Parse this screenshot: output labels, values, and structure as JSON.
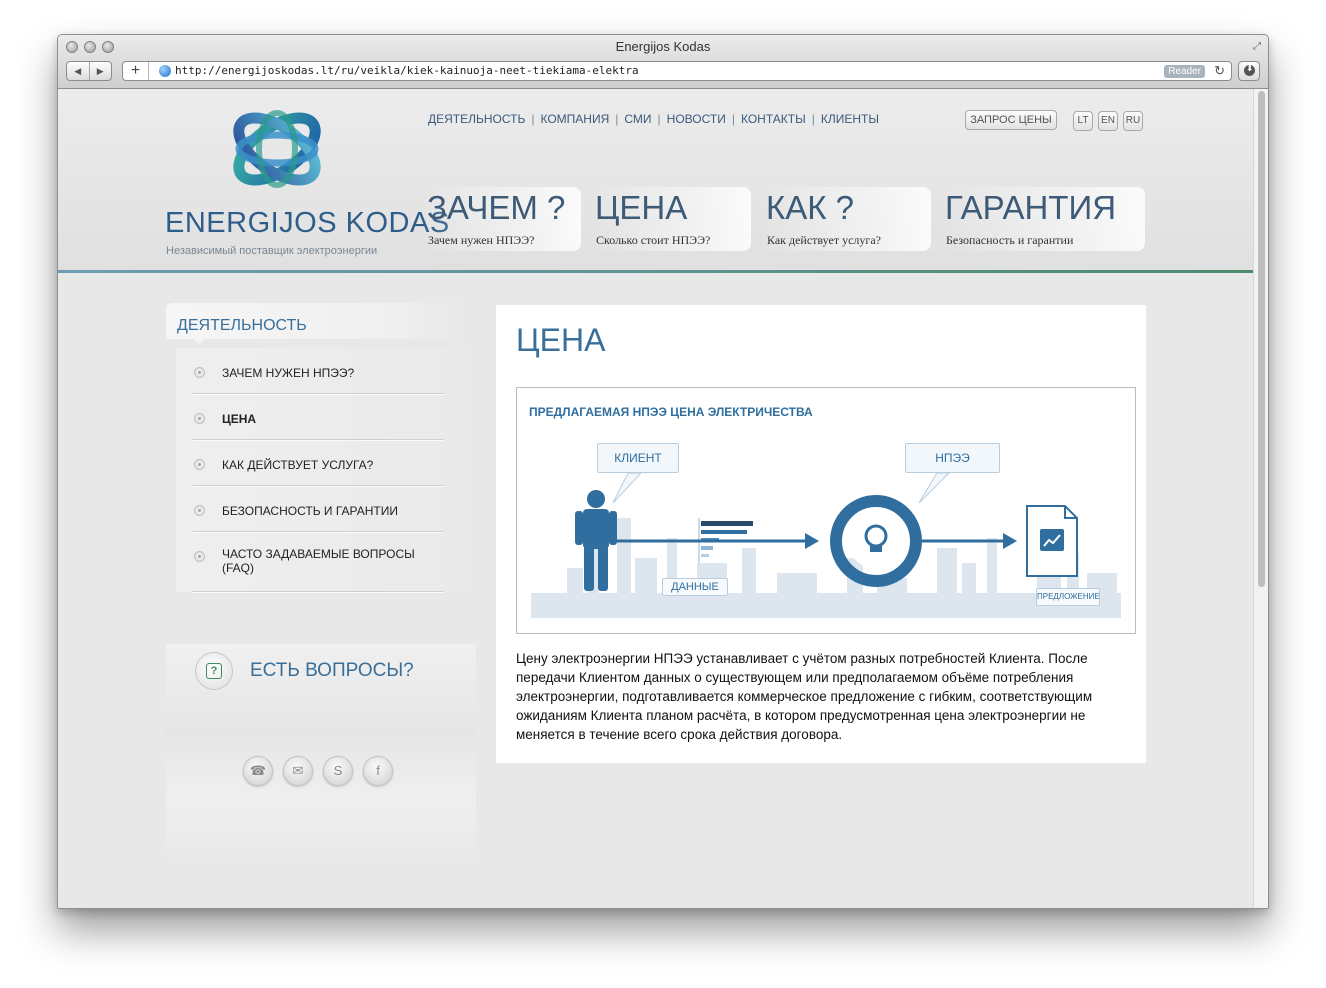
{
  "browser": {
    "window_title": "Energijos Kodas",
    "url": "http://energijoskodas.lt/ru/veikla/kiek-kainuoja-neet-tiekiama-elektra",
    "reader_label": "Reader"
  },
  "header": {
    "brand": "ENERGIJOS KODAS",
    "tagline": "Независимый поставщик электроэнергии",
    "top_nav": [
      "ДЕЯТЕЛЬНОСТЬ",
      "КОМПАНИЯ",
      "СМИ",
      "НОВОСТИ",
      "КОНТАКТЫ",
      "КЛИЕНТЫ"
    ],
    "nav_separator": "|",
    "quote_button": "ЗАПРОС ЦЕНЫ",
    "languages": [
      "LT",
      "EN",
      "RU"
    ],
    "tabs": [
      {
        "title": "ЗАЧЕМ ?",
        "subtitle": "Зачем нужен НПЭЭ?"
      },
      {
        "title": "ЦЕНА",
        "subtitle": "Сколько стоит НПЭЭ?"
      },
      {
        "title": "КАК ?",
        "subtitle": "Как действует услуга?"
      },
      {
        "title": "ГАРАНТИЯ",
        "subtitle": "Безопасность и гарантии"
      }
    ]
  },
  "sidebar": {
    "title": "ДЕЯТЕЛЬНОСТЬ",
    "items": [
      {
        "label": "ЗАЧЕМ НУЖЕН НПЭЭ?"
      },
      {
        "label": "ЦЕНА"
      },
      {
        "label": "КАК ДЕЙСТВУЕТ УСЛУГА?"
      },
      {
        "label": "БЕЗОПАСНОСТЬ И ГАРАНТИИ"
      },
      {
        "label": "ЧАСТО ЗАДАВАЕМЫЕ ВОПРОСЫ (FAQ)"
      }
    ],
    "active_index": 1,
    "questions": {
      "title": "ЕСТЬ ВОПРОСЫ?",
      "icons": [
        "phone-icon",
        "mail-icon",
        "skype-icon",
        "facebook-icon"
      ]
    }
  },
  "main": {
    "title": "ЦЕНА",
    "figure": {
      "title": "ПРЕДЛАГАЕМАЯ НПЭЭ ЦЕНА ЭЛЕКТРИЧЕСТВА",
      "client_label": "КЛИЕНТ",
      "supplier_label": "НПЭЭ",
      "data_label": "ДАННЫЕ",
      "offer_label": "ПРЕДЛОЖЕНИЕ"
    },
    "paragraph": "Цену электроэнергии НПЭЭ устанавливает с учётом разных потребностей Клиента. После передачи Клиентом данных о существующем или предполагаемом объёме потребления электроэнергии, подготавливается коммерческое предложение с гибким, соответствующим ожиданиям Клиента планом расчёта, в котором предусмотренная цена электроэнергии не меняется в течение всего срока действия договора."
  },
  "colors": {
    "accent": "#3a6f9a",
    "diagram_blue": "#2f6e9e",
    "header_line": "#4d8b6e"
  }
}
